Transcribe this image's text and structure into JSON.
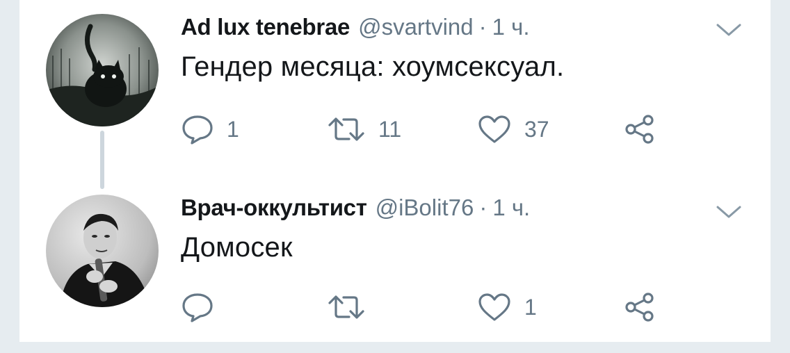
{
  "tweets": [
    {
      "author_name": "Ad lux tenebrae",
      "handle": "@svartvind",
      "separator": "·",
      "time": "1 ч.",
      "text": "Гендер месяца: хоумсексуал.",
      "avatar_icon": "black-cat-in-forest-avatar",
      "reply_count": "1",
      "retweet_count": "11",
      "like_count": "37"
    },
    {
      "author_name": "Врач-оккультист",
      "handle": "@iBolit76",
      "separator": "·",
      "time": "1 ч.",
      "text": "Домосек",
      "avatar_icon": "vintage-man-portrait-avatar",
      "reply_count": "",
      "retweet_count": "",
      "like_count": "1"
    }
  ],
  "icons": {
    "reply": "reply-icon",
    "retweet": "retweet-icon",
    "like": "heart-icon",
    "share": "share-icon",
    "menu": "chevron-down-icon"
  },
  "colors": {
    "text": "#14171a",
    "secondary": "#657786",
    "background": "#e6ecf0",
    "card": "#ffffff",
    "thread_line": "#cdd6dd"
  }
}
